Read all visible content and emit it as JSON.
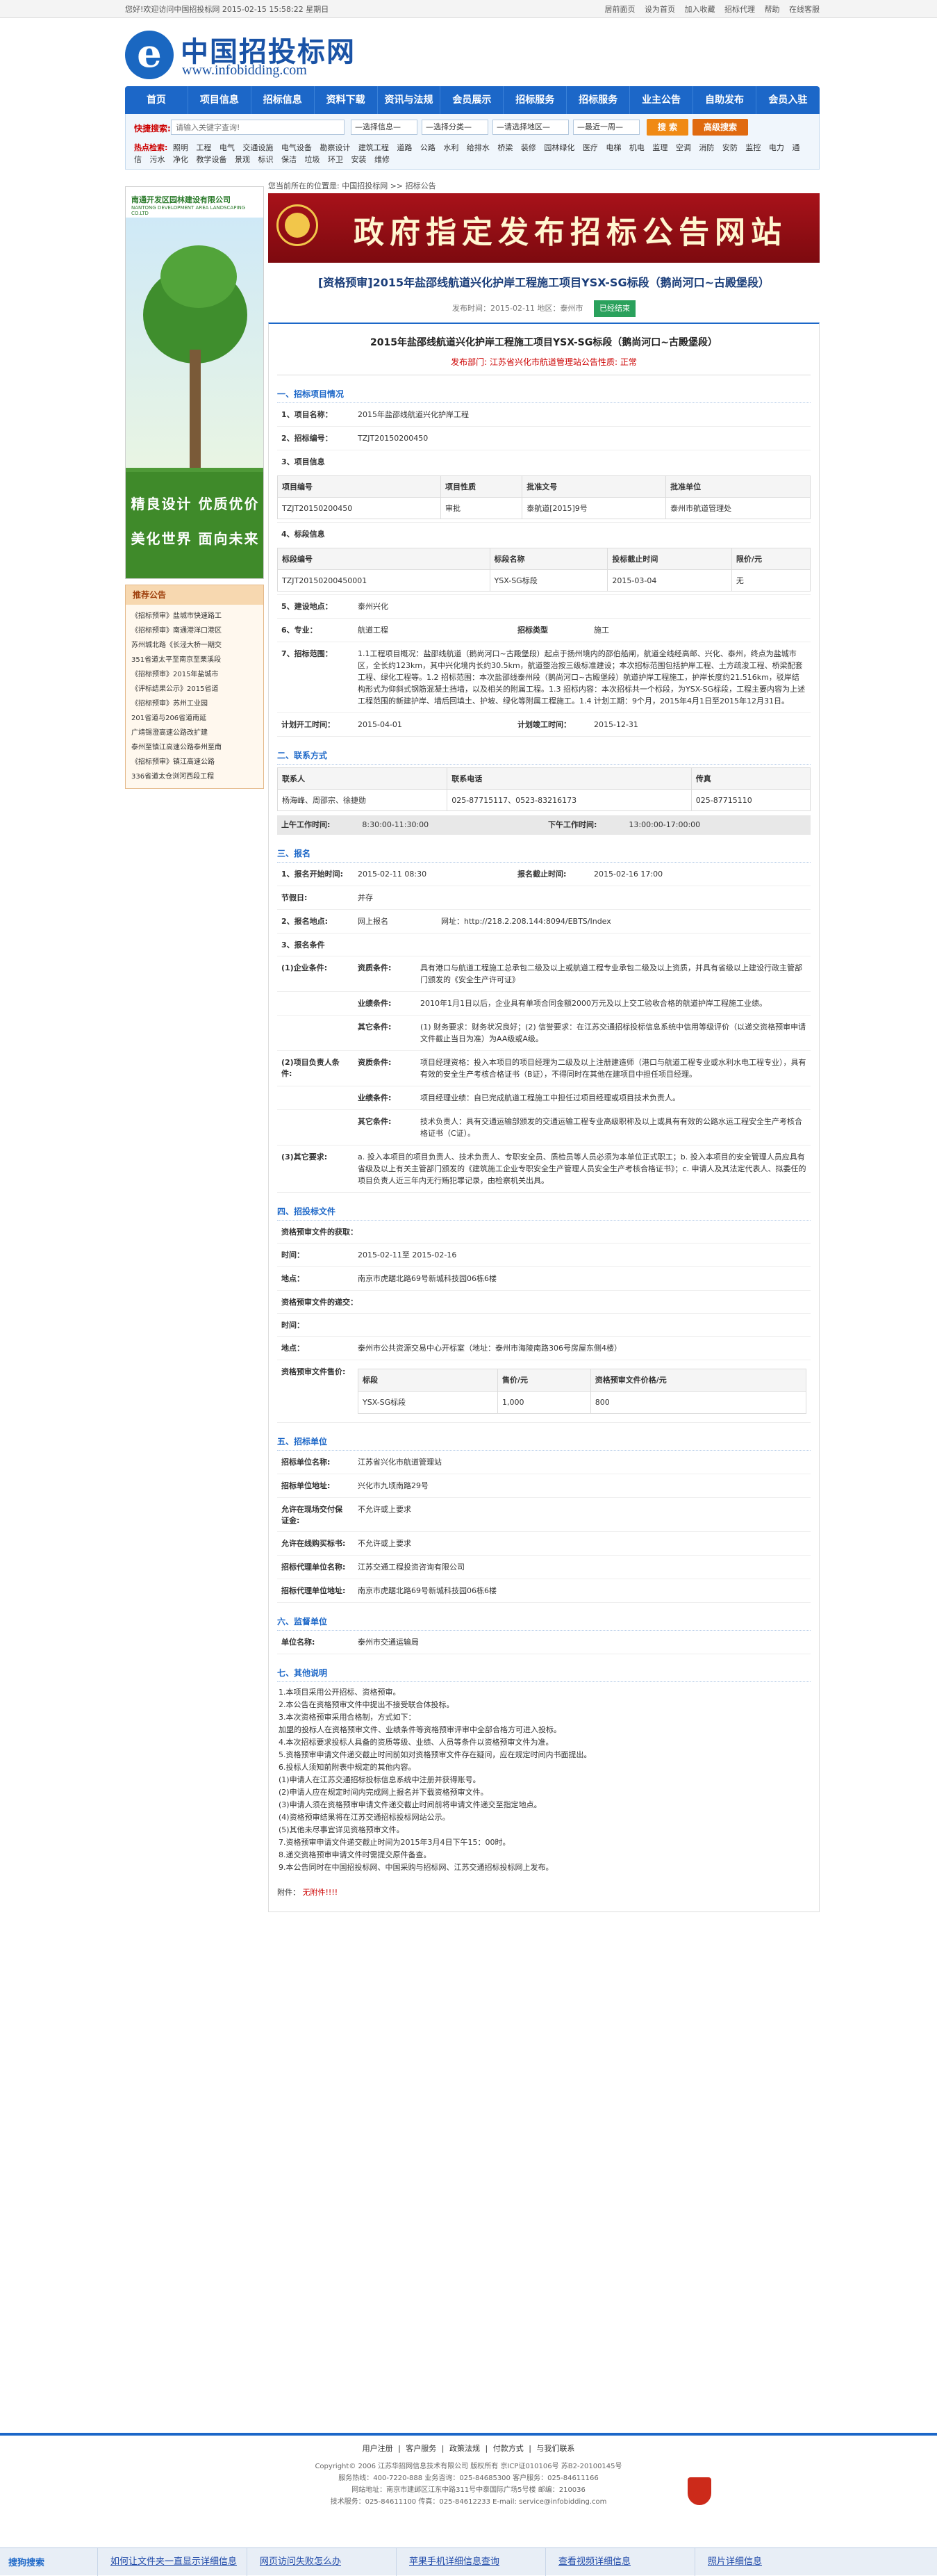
{
  "topbar": {
    "greeting": "您好!欢迎访问中国招投标网  2015-02-15 15:58:22  星期日",
    "links": [
      "居前面页",
      "设为首页",
      "加入收藏",
      "招标代理",
      "帮助",
      "在线客服"
    ]
  },
  "header": {
    "logo_letter": "e",
    "site_name": "中国招投标网",
    "site_url": "www.infobidding.com"
  },
  "nav": [
    "首页",
    "项目信息",
    "招标信息",
    "资料下载",
    "资讯与法规",
    "会员展示",
    "招标服务",
    "招标服务",
    "业主公告",
    "自助发布",
    "会员入驻"
  ],
  "search": {
    "label": "快捷搜索:",
    "placeholder": "请输入关键字查询!",
    "selects": [
      "—选择信息—",
      "—选择分类—",
      "—请选择地区—",
      "—最近一周—"
    ],
    "search_btn": "搜 索",
    "advanced_btn": "高级搜索",
    "hot_label": "热点检索:",
    "hot_words": [
      "照明",
      "工程",
      "电气",
      "交通设施",
      "电气设备",
      "勘察设计",
      "建筑工程",
      "道路",
      "公路",
      "水利",
      "给排水",
      "桥梁",
      "装修",
      "园林绿化",
      "医疗",
      "电梯",
      "机电",
      "监理",
      "空调",
      "消防",
      "安防",
      "监控",
      "电力",
      "通信",
      "污水",
      "净化",
      "教学设备",
      "景观",
      "标识",
      "保洁",
      "垃圾",
      "环卫",
      "安装",
      "维修"
    ]
  },
  "sidebar": {
    "banner_company": "南通开发区园林建设有限公司",
    "banner_company_en": "NANTONG DEVELOPMENT AREA LANDSCAPING CO.LTD",
    "slogan1": "精良设计  优质优价",
    "slogan2": "美化世界  面向未来",
    "box_title": "推荐公告",
    "items": [
      "《招标预审》盐城市快速路工",
      "《招标预审》南通港洋口港区",
      "苏州城北路《长泾大桥一期交",
      "351省道太平至南京至栗溪段",
      "《招标预审》2015年盐城市",
      "《评标结果公示》2015省道",
      "《招标预审》苏州工业园",
      "201省道与206省道南延",
      "广靖锡澄高速公路改扩建",
      "泰州至镇江高速公路泰州至南",
      "《招标预审》镇江高速公路",
      "336省道太仓浏河西段工程"
    ]
  },
  "main": {
    "crumb": "您当前所在的位置是: 中国招投标网 >> 招标公告",
    "banner_text": "政府指定发布招标公告网站",
    "title": "[资格预审]2015年盐邵线航道兴化护岸工程施工项目YSX-SG标段（鹅尚河口~古殿堡段）",
    "meta": "发布时间：2015-02-11    地区：泰州市",
    "status_badge": "已经结束",
    "doc_title": "2015年盐邵线航道兴化护岸工程施工项目YSX-SG标段（鹅尚河口~古殿堡段）",
    "doc_sub": "发布部门: 江苏省兴化市航道管理站公告性质: 正常",
    "sec1": "一、招标项目情况",
    "project_name_k": "1、项目名称：",
    "project_name_v": "2015年盐邵线航道兴化护岸工程",
    "tender_no_k": "2、招标编号：",
    "tender_no_v": "TZJT20150200450",
    "project_info_k": "3、项目信息",
    "project_table_headers": [
      "项目编号",
      "项目性质",
      "批准文号",
      "批准单位"
    ],
    "project_table_row": [
      "TZJT20150200450",
      "审批",
      "泰航道[2015]9号",
      "泰州市航道管理处"
    ],
    "section_info_k": "4、标段信息",
    "section_table_headers": [
      "标段编号",
      "标段名称",
      "投标截止时间",
      "限价/元"
    ],
    "section_table_row": [
      "TZJT20150200450001",
      "YSX-SG标段",
      "2015-03-04",
      "无"
    ],
    "location_k": "5、建设地点：",
    "location_v": "泰州兴化",
    "major_k": "6、专业：",
    "major_v": "航道工程",
    "tender_type_k": "招标类型",
    "tender_type_v": "施工",
    "scope_k": "7、招标范围：",
    "scope_v": "1.1工程项目概况：盐邵线航道（鹅尚河口~古殿堡段）起点于扬州境内的邵伯船闸，航道全线经高邮、兴化、泰州，终点为盐城市区，全长约123km，其中兴化境内长约30.5km，航道整治按三级标准建设；本次招标范围包括护岸工程、土方疏浚工程、桥梁配套工程、绿化工程等。1.2 招标范围：本次盐邵线泰州段（鹅尚河口~古殿堡段）航道护岸工程施工，护岸长度约21.516km，驳岸结构形式为仰斜式钢筋混凝土挡墙，以及相关的附属工程。1.3 招标内容：本次招标共一个标段，为YSX-SG标段，工程主要内容为上述工程范围的新建护岸、墙后回填土、护坡、绿化等附属工程施工。1.4 计划工期：9个月，2015年4月1日至2015年12月31日。",
    "plan_start_k": "计划开工时间：",
    "plan_start_v": "2015-04-01",
    "plan_end_k": "计划竣工时间：",
    "plan_end_v": "2015-12-31",
    "sec2": "二、联系方式",
    "contact_headers": [
      "联系人",
      "联系电话",
      "传真"
    ],
    "contact_row": [
      "杨海峰、周邵宗、徐捷勋",
      "025-87715117、0523-83216173",
      "025-87715110"
    ],
    "am_label": "上午工作时间:",
    "am_time": "8:30:00-11:30:00",
    "pm_label": "下午工作时间:",
    "pm_time": "13:00:00-17:00:00",
    "sec3": "三、报名",
    "reg_start_k": "1、报名开始时间:",
    "reg_start_v": "2015-02-11 08:30",
    "reg_end_k": "报名截止时间:",
    "reg_end_v": "2015-02-16 17:00",
    "node_k": "节假日:",
    "node_v": "并存",
    "reg_method_k": "2、报名地点:",
    "reg_method_v": "网上报名",
    "reg_url": "网址：http://218.2.208.144:8094/EBTS/Index",
    "cond_k": "3、报名条件",
    "ent_k": "(1)企业条件:",
    "qual_k": "资质条件:",
    "qual_v": "具有港口与航道工程施工总承包二级及以上或航道工程专业承包二级及以上资质，并具有省级以上建设行政主管部门颁发的《安全生产许可证》",
    "perf_k": "业绩条件:",
    "perf_v": "2010年1月1日以后，企业具有单项合同金额2000万元及以上交工验收合格的航道护岸工程施工业绩。",
    "other_k": "其它条件:",
    "other_v": "(1) 财务要求：财务状况良好；(2) 信誉要求：在江苏交通招标投标信息系统中信用等级评价（以递交资格预审申请文件截止当日为准）为AA级或A级。",
    "person_k": "(2)项目负责人条件:",
    "pqual_v": "项目经理资格：投入本项目的项目经理为二级及以上注册建造师（港口与航道工程专业或水利水电工程专业），具有有效的安全生产考核合格证书（B证），不得同时在其他在建项目中担任项目经理。",
    "pperf_v": "项目经理业绩：自已完成航道工程施工中担任过项目经理或项目技术负责人。",
    "pother_v": "技术负责人：具有交通运输部颁发的交通运输工程专业高级职称及以上或具有有效的公路水运工程安全生产考核合格证书（C证）。",
    "other_req_k": "(3)其它要求:",
    "other_req_v": "a. 投入本项目的项目负责人、技术负责人、专职安全员、质检员等人员必须为本单位正式职工；b. 投入本项目的安全管理人员应具有省级及以上有关主管部门颁发的《建筑施工企业专职安全生产管理人员安全生产考核合格证书》；c. 申请人及其法定代表人、拟委任的项目负责人近三年内无行贿犯罪记录，由检察机关出具。",
    "sec4": "四、招投标文件",
    "doc_get_k": "资格预审文件的获取：",
    "time_k": "时间：",
    "time_v": "2015-02-11至 2015-02-16",
    "place_k": "地点：",
    "place_v": "南京市虎踞北路69号新城科技园06栋6楼",
    "doc_submit_k": "资格预审文件的递交：",
    "time2_k": "时间：",
    "time2_v": "",
    "place2_k": "地点：",
    "place2_v": "泰州市公共资源交易中心开标室（地址：泰州市海陵南路306号房屋东侧4楼）",
    "fee_k": "资格预审文件售价:",
    "fee_headers": [
      "标段",
      "售价/元",
      "资格预审文件价格/元"
    ],
    "fee_row": [
      "YSX-SG标段",
      "1,000",
      "800"
    ],
    "sec5": "五、招标单位",
    "org_name_k": "招标单位名称:",
    "org_name_v": "江苏省兴化市航道管理站",
    "org_addr_k": "招标单位地址:",
    "org_addr_v": "兴化市九顷南路29号",
    "recv_k": "允许在现场交付保证金:",
    "recv_v": "不允许或上要求",
    "online_k": "允许在线购买标书:",
    "online_v": "不允许或上要求",
    "agent_name_k": "招标代理单位名称:",
    "agent_name_v": "江苏交通工程投资咨询有限公司",
    "agent_addr_k": "招标代理单位地址:",
    "agent_addr_v": "南京市虎踞北路69号新城科技园06栋6楼",
    "sec6": "六、监督单位",
    "sup_k": "单位名称:",
    "sup_v": "泰州市交通运输局",
    "sec7": "七、其他说明",
    "notes": [
      "1.本项目采用公开招标、资格预审。",
      "2.本公告在资格预审文件中提出不接受联合体投标。",
      "3.本次资格预审采用合格制，方式如下：",
      "加盟的投标人在资格预审文件、业绩条件等资格预审评审中全部合格方可进入投标。",
      "4.本次招标要求投标人具备的资质等级、业绩、人员等条件以资格预审文件为准。",
      "5.资格预审申请文件递交截止时间前如对资格预审文件存在疑问，应在规定时间内书面提出。",
      "6.投标人须知前附表中规定的其他内容。",
      "(1)申请人在江苏交通招标投标信息系统中注册并获得账号。",
      "(2)申请人应在规定时间内完成网上报名并下载资格预审文件。",
      "(3)申请人须在资格预审申请文件递交截止时间前将申请文件递交至指定地点。",
      "(4)资格预审结果将在江苏交通招标投标网站公示。",
      "(5)其他未尽事宜详见资格预审文件。",
      "7.资格预审申请文件递交截止时间为2015年3月4日下午15：00时。",
      "8.递交资格预审申请文件时需提交原件备查。",
      "9.本公告同时在中国招投标网、中国采购与招标网、江苏交通招标投标网上发布。"
    ],
    "attach_label": "附件：",
    "attach_v": "无附件!!!!"
  },
  "footer": {
    "links": [
      "用户注册",
      "客户服务",
      "政策法规",
      "付款方式",
      "与我们联系"
    ],
    "info": [
      "Copyright© 2006 江苏华招网信息技术有限公司 版权所有 京ICP证010106号 苏B2-20100145号",
      "服务热线：400-7220-888 业务咨询：025-84685300 客户服务：025-84611166",
      "网站地址：南京市建邺区江东中路311号中泰国际广场5号楼 邮编：210036",
      "技术服务：025-84611100 传真：025-84612233 E-mail: service@infobidding.com"
    ]
  },
  "bottombar": {
    "logo": "搜狗搜索",
    "items": [
      "如何让文件夹一直显示详细信息",
      "网页访问失败怎么办",
      "苹果手机详细信息查询",
      "查看视频详细信息",
      "照片详细信息"
    ]
  }
}
